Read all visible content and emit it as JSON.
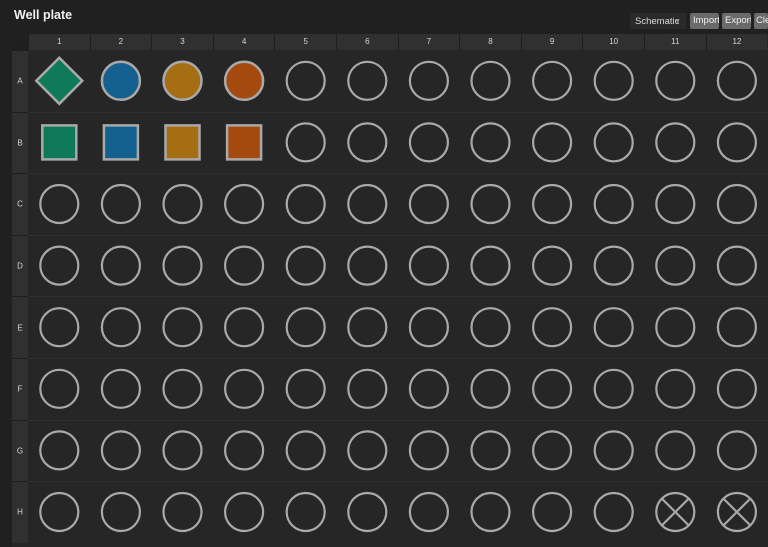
{
  "app": {
    "title": "Well plate",
    "view_select": "Schematic",
    "buttons": {
      "import": "Import",
      "export": "Export",
      "clear": "Cle"
    }
  },
  "plate": {
    "columns": [
      "1",
      "2",
      "3",
      "4",
      "5",
      "6",
      "7",
      "8",
      "9",
      "10",
      "11",
      "12"
    ],
    "rows": [
      "A",
      "B",
      "C",
      "D",
      "E",
      "F",
      "G",
      "H"
    ],
    "colors": {
      "green": "#0e7a5a",
      "blue": "#14618f",
      "gold": "#a56e12",
      "orange": "#a44a0f",
      "outline": "#a9a9a9"
    },
    "filled_wells": [
      {
        "row": "A",
        "col": "1",
        "shape": "diamond",
        "color": "green"
      },
      {
        "row": "A",
        "col": "2",
        "shape": "circle",
        "color": "blue"
      },
      {
        "row": "A",
        "col": "3",
        "shape": "circle",
        "color": "gold"
      },
      {
        "row": "A",
        "col": "4",
        "shape": "circle",
        "color": "orange"
      },
      {
        "row": "B",
        "col": "1",
        "shape": "square",
        "color": "green"
      },
      {
        "row": "B",
        "col": "2",
        "shape": "square",
        "color": "blue"
      },
      {
        "row": "B",
        "col": "3",
        "shape": "square",
        "color": "gold"
      },
      {
        "row": "B",
        "col": "4",
        "shape": "square",
        "color": "orange"
      }
    ],
    "excluded_wells": [
      {
        "row": "H",
        "col": "11"
      },
      {
        "row": "H",
        "col": "12"
      }
    ]
  }
}
